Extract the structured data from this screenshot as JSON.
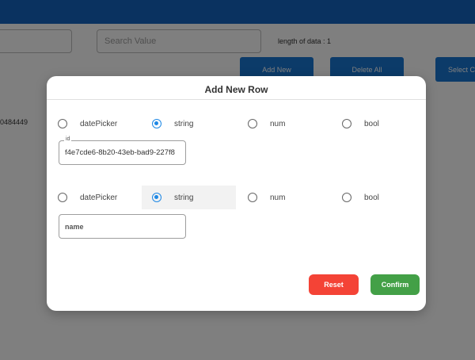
{
  "background": {
    "search_placeholder": "Search Value",
    "length_label": "length of data : ",
    "length_value": "1",
    "buttons": {
      "add_new": "Add New",
      "delete_all": "Delete All",
      "select_columns": "Select Co"
    },
    "row_cell_text": "0484449"
  },
  "modal": {
    "title": "Add New Row",
    "rows": [
      {
        "options": [
          "datePicker",
          "string",
          "num",
          "bool"
        ],
        "selected": "string",
        "field_legend": "id",
        "field_value": "f4e7cde6-8b20-43eb-bad9-227f8"
      },
      {
        "options": [
          "datePicker",
          "string",
          "num",
          "bool"
        ],
        "selected": "string",
        "field_placeholder": "name"
      }
    ],
    "reset_label": "Reset",
    "confirm_label": "Confirm"
  },
  "colors": {
    "topbar": "#1565c0",
    "primary_button": "#1976d2",
    "radio_selected": "#1e88e5",
    "reset": "#f44336",
    "confirm": "#43a047"
  }
}
